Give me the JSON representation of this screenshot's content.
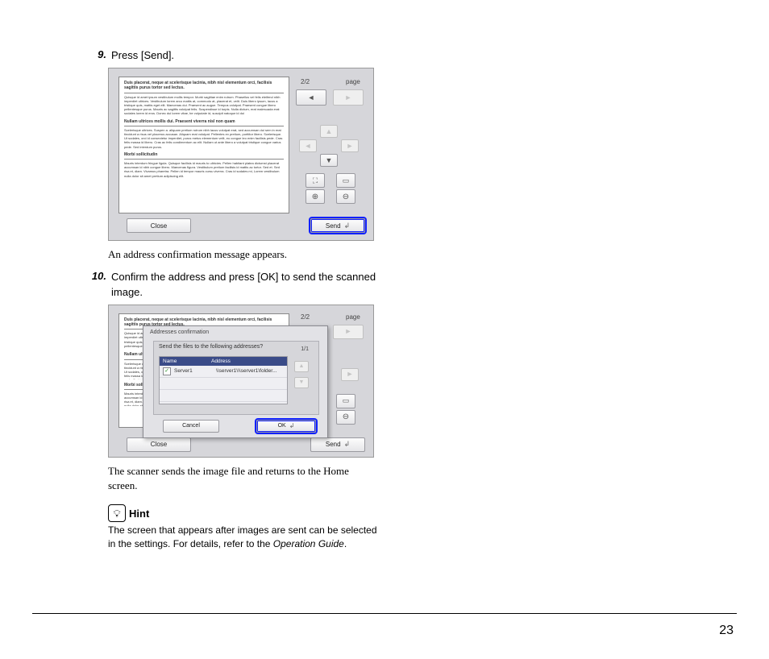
{
  "steps": {
    "s9_num": "9.",
    "s9_text": "Press [Send].",
    "s9_after": "An address confirmation message appears.",
    "s10_num": "10.",
    "s10_text": "Confirm the address and press [OK] to send the scanned image.",
    "s10_after": "The scanner sends the image file and returns to the Home screen."
  },
  "hint": {
    "label": "Hint",
    "text_a": "The screen that appears after images are sent can be selected in the settings. For details, refer to the ",
    "text_b": "Operation Guide",
    "text_c": "."
  },
  "page_number": "23",
  "viewer": {
    "page_indicator": "2/2",
    "page_label": "page",
    "close": "Close",
    "send": "Send"
  },
  "dialog": {
    "title": "Addresses confirmation",
    "question": "Send the files to the following addresses?",
    "header_name": "Name",
    "header_address": "Address",
    "page_ind": "1/1",
    "row_name": "Server1",
    "row_addr": "\\\\server1\\\\\\server1\\folder...",
    "cancel": "Cancel",
    "ok": "OK"
  },
  "lorem": {
    "h1": "Duis placerat, neque at scelerisque lacinia, nibh nisl elementum orci, facilisis sagittis purus tortor sed lectus.",
    "p1": "Quisque id amet ipsum vestibulum mollis tempor. Morbi sagittae enim rutrum. Phasellus vel felis eleifend nibh imperdiet ultrices. Vestibulum lorem arcu mattis at, commodo at, placerat et, velit. Duis libero ipsum, lacus a tristique quis, mattis eget elit. Maecenas dui. Praesent ac augue. Tempus volutpat. Praesent congue libero pellentesque purus. Mauris ac sagittis volutpat felis. Suspendisse id turpis. Nulla dictum, erat malesuada erat sodales lorem id eros. Donec dui lorem vitae, be vulputate id, suscipit natoque id dui",
    "h2": "Nullam ultrices mollis dui. Praesent viverra nisl non quam",
    "p2": "Scelerisque ultrices. Suspen a. aliquam pretium rutrum nibh lacus volutpat erat, sed accumsan dui sem in erat tincidunt a risus vel placerus accusan. Aliquam erat volutpat. Pellentes ex pretium, porttitor libero. Scelerisque. Ut sodales, orci id consectetur imperdiet, purus metus elementum velit, eu congue leo enim facilisis pede. Cras felis massa id libero. Cras ac felis condimentum ac elit. Nullam ut ante libero a volutpat tristique congue varius pede. Sed interdum purus.",
    "h3": "Morbi sollicitudin",
    "p3": "Mauris interdum fringue ligula. Quisque facilisis id mauris to ultricies. Pellen habitant platea dictumst placerat accumsan id nibh congue libero. Maecenas figura. Vestibulum pretium facilisis id mattis ac tortor. Sed et. Sed risa et, diam. Vivamus pharetra. Pellen id tempor mauris cursu viverra. Cras id sodales mi, Lorem vestibulum nulla dolor sit amet pretium adipiscing elit."
  }
}
